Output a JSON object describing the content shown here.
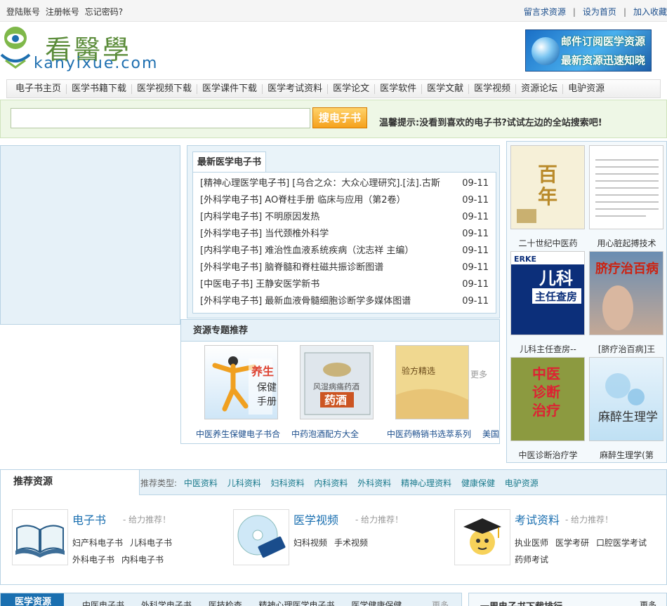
{
  "topbar": {
    "left_links": [
      "登陆账号",
      "注册帐号",
      "忘记密码?"
    ],
    "right_links": [
      "留言求资源",
      "设为首页",
      "加入收藏"
    ],
    "separator": "|"
  },
  "logo": {
    "chinese": "看醫學",
    "domain": "kanyixue.com"
  },
  "banner": {
    "line1": "邮件订阅医学资源",
    "line2": "最新资源迅速知晓"
  },
  "nav": [
    "电子书主页",
    "医学书籍下载",
    "医学视频下载",
    "医学课件下载",
    "医学考试资料",
    "医学论文",
    "医学软件",
    "医学文献",
    "医学视频",
    "资源论坛",
    "电驴资源"
  ],
  "search": {
    "value": "",
    "button": "搜电子书",
    "tip": "温馨提示:没看到喜欢的电子书?试试左边的全站搜索吧!"
  },
  "newest": {
    "title": "最新医学电子书",
    "items": [
      {
        "title": "[精神心理医学电子书] [乌合之众：大众心理研究].[法].古斯",
        "date": "09-11"
      },
      {
        "title": "[外科学电子书] AO脊柱手册 临床与应用（第2卷）",
        "date": "09-11"
      },
      {
        "title": "[内科学电子书] 不明原因发热",
        "date": "09-11"
      },
      {
        "title": "[外科学电子书] 当代颈椎外科学",
        "date": "09-11"
      },
      {
        "title": "[内科学电子书] 难治性血液系统疾病（沈志祥 主编）",
        "date": "09-11"
      },
      {
        "title": "[外科学电子书] 脑脊髓和脊柱磁共振诊断图谱",
        "date": "09-11"
      },
      {
        "title": "[中医电子书] 王静安医学新书",
        "date": "09-11"
      },
      {
        "title": "[外科学电子书] 最新血液骨髓细胞诊断学多媒体图谱",
        "date": "09-11"
      }
    ]
  },
  "topics": {
    "title": "资源专题推荐",
    "more": "更多",
    "items": [
      {
        "caption": "中医养生保健电子书合"
      },
      {
        "caption": "中药泡酒配方大全"
      },
      {
        "caption": "中医药畅销书选萃系列"
      },
      {
        "caption": "美国"
      }
    ]
  },
  "covers": [
    {
      "caption": "二十世纪中医药"
    },
    {
      "caption": "用心脏起搏技术"
    },
    {
      "caption": "儿科主任查房--"
    },
    {
      "caption": "[脐疗治百病]王"
    },
    {
      "caption": "中医诊断治疗学"
    },
    {
      "caption": "麻醉生理学(第"
    }
  ],
  "recommend": {
    "title": "推荐资源",
    "types_label": "推荐类型:",
    "types": [
      "中医资料",
      "儿科资料",
      "妇科资料",
      "内科资料",
      "外科资料",
      "精神心理资料",
      "健康保健",
      "电驴资源"
    ],
    "items": [
      {
        "name": "电子书",
        "sub": "- 给力推荐！",
        "links": [
          "妇产科电子书",
          "儿科电子书",
          "外科电子书",
          "内科电子书"
        ]
      },
      {
        "name": "医学视频",
        "sub": "- 给力推荐！",
        "links": [
          "妇科视频",
          "手术视频"
        ]
      },
      {
        "name": "考试资料",
        "sub": "- 给力推荐！",
        "links": [
          "执业医师",
          "医学考研",
          "口腔医学考试",
          "药师考试"
        ]
      }
    ]
  },
  "bottom": {
    "left_tab": "医学资源",
    "left_links": [
      "中医电子书",
      "外科学电子书",
      "医技检查",
      "精神心理医学电子书",
      "医学健康保健"
    ],
    "left_more": "更多",
    "right_title": "一周电子书下载排行",
    "right_more": "更多"
  },
  "colors": {
    "accent_blue": "#1a6fb0",
    "panel_bg": "#e6f1f8",
    "border": "#b9d3e4",
    "search_bg": "#eef7e6",
    "search_button": "#f5a11c"
  }
}
